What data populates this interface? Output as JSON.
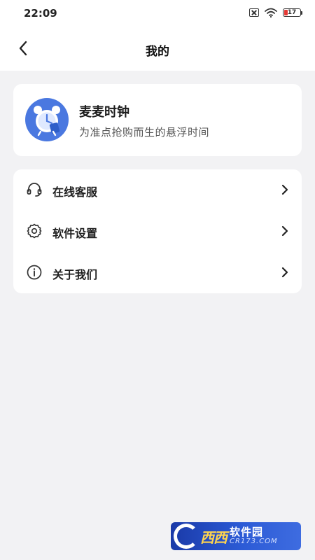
{
  "status_bar": {
    "time": "22:09",
    "battery_level": "17",
    "icons": [
      "sim-disabled-icon",
      "wifi-icon",
      "battery-icon"
    ]
  },
  "header": {
    "title": "我的",
    "back_icon": "chevron-left-icon"
  },
  "app_info": {
    "name": "麦麦时钟",
    "slogan": "为准点抢购而生的悬浮时间",
    "logo_icon": "alarm-clock-icon",
    "logo_color": "#4a78e0"
  },
  "menu": {
    "items": [
      {
        "label": "在线客服",
        "icon": "headset-icon"
      },
      {
        "label": "软件设置",
        "icon": "gear-icon"
      },
      {
        "label": "关于我们",
        "icon": "info-icon"
      }
    ],
    "chevron_icon": "chevron-right-icon"
  },
  "watermark": {
    "brand": "西西",
    "site_name": "软件园",
    "site_url": "CR173.COM"
  },
  "colors": {
    "background": "#f2f2f4",
    "card": "#ffffff",
    "accent": "#4a78e0",
    "battery_low": "#e53935"
  }
}
